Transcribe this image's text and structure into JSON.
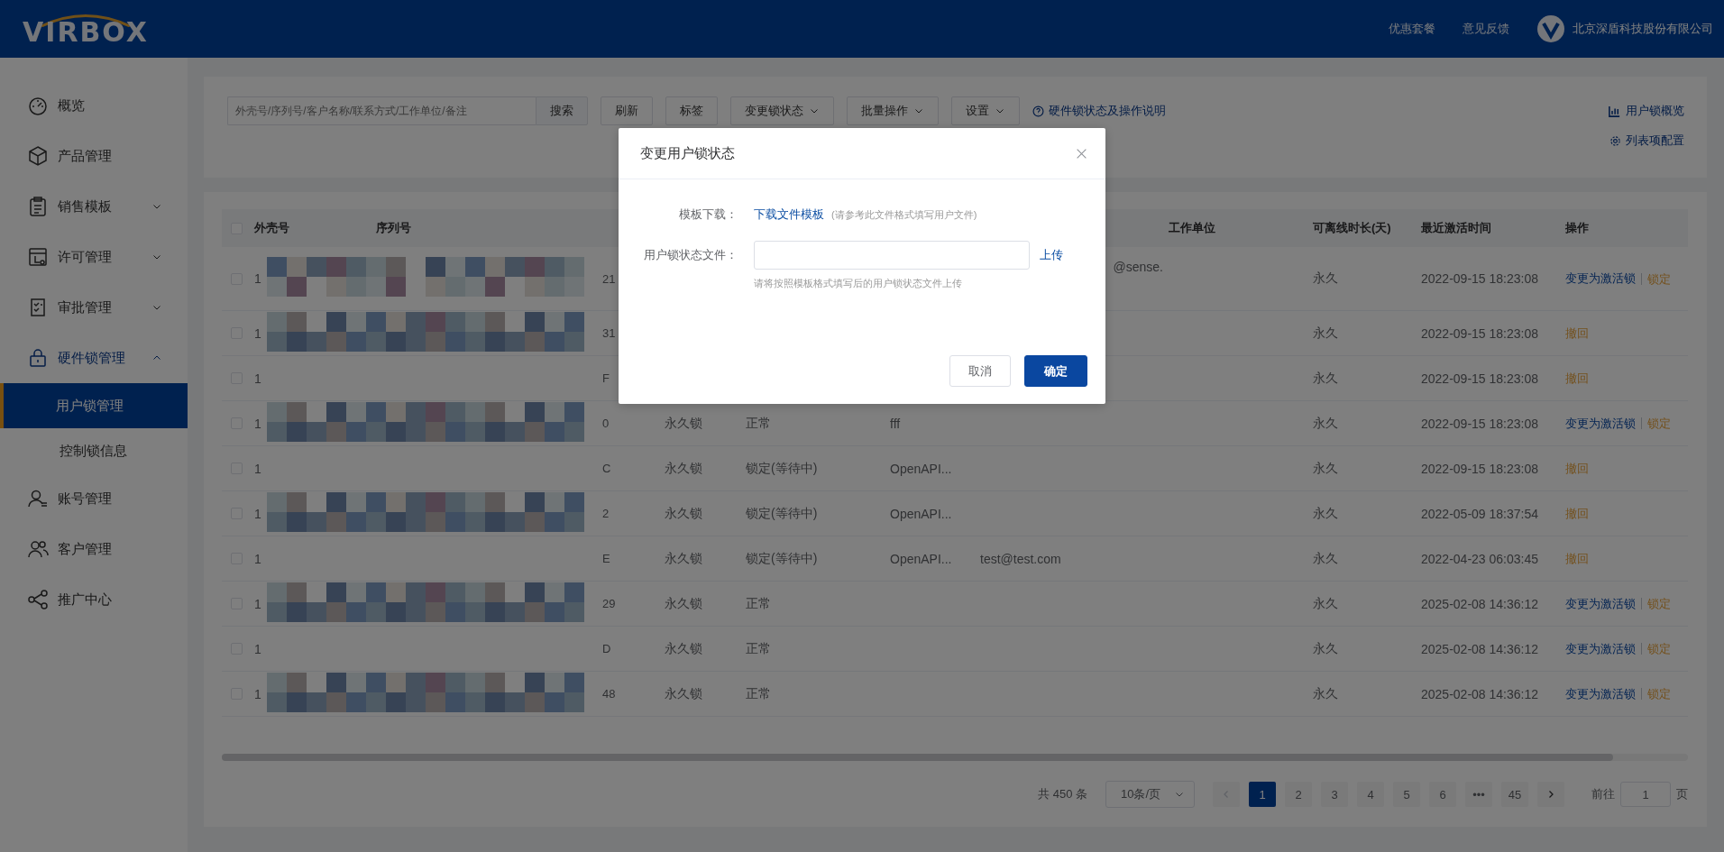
{
  "header": {
    "logo": "VIRBOX",
    "links": [
      "优惠套餐",
      "意见反馈"
    ],
    "company": "北京深盾科技股份有限公司"
  },
  "sidebar": {
    "items": [
      {
        "label": "概览",
        "selected": false
      },
      {
        "label": "产品管理",
        "selected": false
      },
      {
        "label": "销售模板",
        "selected": false,
        "expanded": false
      },
      {
        "label": "许可管理",
        "selected": false,
        "expanded": false
      },
      {
        "label": "审批管理",
        "selected": false,
        "expanded": false
      },
      {
        "label": "硬件锁管理",
        "selected": false,
        "expanded": true,
        "children": [
          {
            "label": "用户锁管理",
            "selected": true
          },
          {
            "label": "控制锁信息",
            "selected": false
          }
        ]
      },
      {
        "label": "账号管理",
        "selected": false
      },
      {
        "label": "客户管理",
        "selected": false
      },
      {
        "label": "推广中心",
        "selected": false
      }
    ]
  },
  "toolbar": {
    "search": {
      "placeholder": "外壳号/序列号/客户名称/联系方式/工作单位/备注",
      "button": "搜索"
    },
    "buttons": [
      {
        "label": "刷新",
        "kind": "plain"
      },
      {
        "label": "标签",
        "kind": "plain"
      },
      {
        "label": "变更锁状态",
        "kind": "dropdown"
      },
      {
        "label": "批量操作",
        "kind": "dropdown"
      },
      {
        "label": "设置",
        "kind": "dropdown"
      }
    ],
    "help_link": "硬件锁状态及操作说明",
    "overview_link": "用户锁概览",
    "column_settings": "列表项配置"
  },
  "table": {
    "header_checked": false,
    "columns": [
      "外壳号",
      "序列号",
      "工作单位",
      "可离线时长(天)",
      "最近激活时间",
      "操作"
    ],
    "rows": [
      {
        "checked": false,
        "outer_no": "1",
        "redacted": true,
        "column_3": "21",
        "column_7": "@sense.",
        "offline": "永久",
        "activated": "2022-09-15 18:23:08",
        "actions": [
          {
            "label": "变更为激活锁",
            "kind": "primary"
          },
          {
            "label": "锁定",
            "kind": "warning"
          }
        ]
      },
      {
        "checked": false,
        "outer_no": "1",
        "redacted": true,
        "column_3": "31",
        "offline": "永久",
        "activated": "2022-09-15 18:23:08",
        "actions": [
          {
            "label": "撤回",
            "kind": "warning"
          }
        ]
      },
      {
        "checked": false,
        "outer_no": "1",
        "redacted": false,
        "column_3": "F",
        "offline": "永久",
        "activated": "2022-09-15 18:23:08",
        "actions": [
          {
            "label": "撤回",
            "kind": "warning"
          }
        ]
      },
      {
        "checked": false,
        "outer_no": "1",
        "redacted": true,
        "column_3": "0",
        "column_4": "永久锁",
        "column_5": "正常",
        "column_6": "fff",
        "offline": "永久",
        "activated": "2022-09-15 18:23:08",
        "actions": [
          {
            "label": "变更为激活锁",
            "kind": "primary"
          },
          {
            "label": "锁定",
            "kind": "warning"
          }
        ]
      },
      {
        "checked": false,
        "outer_no": "1",
        "redacted": false,
        "column_3": "C",
        "column_4": "永久锁",
        "column_5": "锁定(等待中)",
        "column_6": "OpenAPI...",
        "offline": "永久",
        "activated": "2022-09-15 18:23:08",
        "actions": [
          {
            "label": "撤回",
            "kind": "warning"
          }
        ]
      },
      {
        "checked": false,
        "outer_no": "1",
        "redacted": true,
        "column_3": "2",
        "column_4": "永久锁",
        "column_5": "锁定(等待中)",
        "column_6": "OpenAPI...",
        "offline": "永久",
        "activated": "2022-05-09 18:37:54",
        "actions": [
          {
            "label": "撤回",
            "kind": "warning"
          }
        ]
      },
      {
        "checked": false,
        "outer_no": "1",
        "redacted": false,
        "column_3": "E",
        "column_4": "永久锁",
        "column_5": "锁定(等待中)",
        "column_6": "OpenAPI...",
        "column_7": "test@test.com",
        "offline": "永久",
        "activated": "2022-04-23 06:03:45",
        "actions": [
          {
            "label": "撤回",
            "kind": "warning"
          }
        ]
      },
      {
        "checked": false,
        "outer_no": "1",
        "redacted": true,
        "column_3": "29",
        "column_4": "永久锁",
        "column_5": "正常",
        "offline": "永久",
        "activated": "2025-02-08 14:36:12",
        "actions": [
          {
            "label": "变更为激活锁",
            "kind": "primary"
          },
          {
            "label": "锁定",
            "kind": "warning"
          }
        ]
      },
      {
        "checked": false,
        "outer_no": "1",
        "redacted": false,
        "column_3": "D",
        "column_4": "永久锁",
        "column_5": "正常",
        "offline": "永久",
        "activated": "2025-02-08 14:36:12",
        "actions": [
          {
            "label": "变更为激活锁",
            "kind": "primary"
          },
          {
            "label": "锁定",
            "kind": "warning"
          }
        ]
      },
      {
        "checked": false,
        "outer_no": "1",
        "redacted": true,
        "column_3": "48",
        "column_4": "永久锁",
        "column_5": "正常",
        "offline": "永久",
        "activated": "2025-02-08 14:36:12",
        "actions": [
          {
            "label": "变更为激活锁",
            "kind": "primary"
          },
          {
            "label": "锁定",
            "kind": "warning"
          }
        ]
      }
    ]
  },
  "pagination": {
    "total": "共 450 条",
    "page_size": "10条/页",
    "pages": [
      {
        "label": "1",
        "selected": true
      },
      {
        "label": "2",
        "selected": false
      },
      {
        "label": "3",
        "selected": false
      },
      {
        "label": "4",
        "selected": false
      },
      {
        "label": "5",
        "selected": false
      },
      {
        "label": "6",
        "selected": false
      },
      {
        "label": "•••",
        "selected": false
      },
      {
        "label": "45",
        "selected": false
      }
    ],
    "goto_label": "前往",
    "goto_value": "1",
    "goto_suffix": "页"
  },
  "modal": {
    "title": "变更用户锁状态",
    "template_label": "模板下载：",
    "template_link": "下载文件模板",
    "template_hint": "(请参考此文件格式填写用户文件)",
    "file_label": "用户锁状态文件：",
    "upload": "上传",
    "file_help": "请将按照模板格式填写后的用户锁状态文件上传",
    "cancel": "取消",
    "confirm": "确定"
  }
}
